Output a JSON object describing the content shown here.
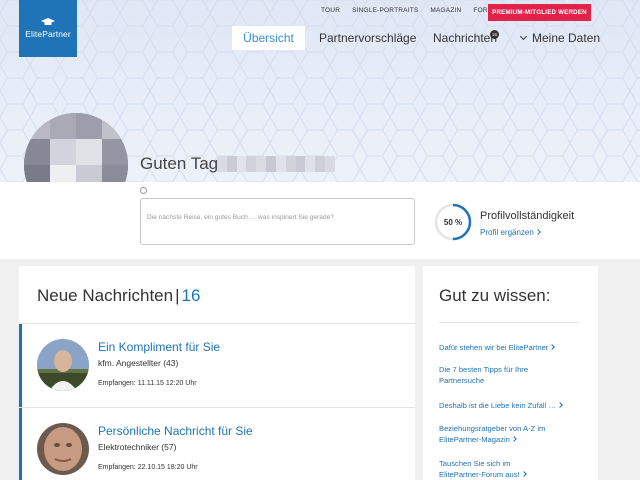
{
  "brand": {
    "name": "ElitePartner",
    "color": "#1f73b7"
  },
  "top_nav": [
    "TOUR",
    "SINGLE-PORTRAITS",
    "MAGAZIN",
    "FORUM"
  ],
  "premium_button": {
    "label": "PREMIUM-MITGLIED WERDEN",
    "color": "#e3224a"
  },
  "main_nav": {
    "active": "Übersicht",
    "partner": "Partnervorschläge",
    "messages": "Nachrichten",
    "messages_badge": "16",
    "my_data": "Meine Daten"
  },
  "greeting": "Guten Tag",
  "status": {
    "placeholder": "Die nächste Reise, ein gutes Buch … was inspiriert Sie gerade?"
  },
  "profile": {
    "percent_label": "50 %",
    "percent": 50,
    "title": "Profilvollständigkeit",
    "link": "Profil ergänzen"
  },
  "messages": {
    "title": "Neue Nachrichten",
    "separator": "|",
    "count": "16",
    "items": [
      {
        "title": "Ein Kompliment für Sie",
        "job": "kfm. Angestellter (43)",
        "date": "Empfangen: 11.11.15 12:20 Uhr"
      },
      {
        "title": "Persönliche Nachricht für Sie",
        "job": "Elektrotechniker (57)",
        "date": "Empfangen: 22.10.15 18:20 Uhr"
      }
    ]
  },
  "good_to_know": {
    "title": "Gut zu wissen:",
    "links": [
      {
        "l1": "Dafür stehen wir bei ElitePartner",
        "l2": ""
      },
      {
        "l1": "Die 7 besten Tipps für Ihre",
        "l2": "Partnersuche"
      },
      {
        "l1": "Deshalb ist die Liebe kein Zufall …",
        "l2": ""
      },
      {
        "l1": "Beziehungsratgeber von A-Z im",
        "l2": "ElitePartner-Magazin"
      },
      {
        "l1": "Tauschen Sie sich im",
        "l2": "ElitePartner-Forum aus!"
      }
    ]
  }
}
